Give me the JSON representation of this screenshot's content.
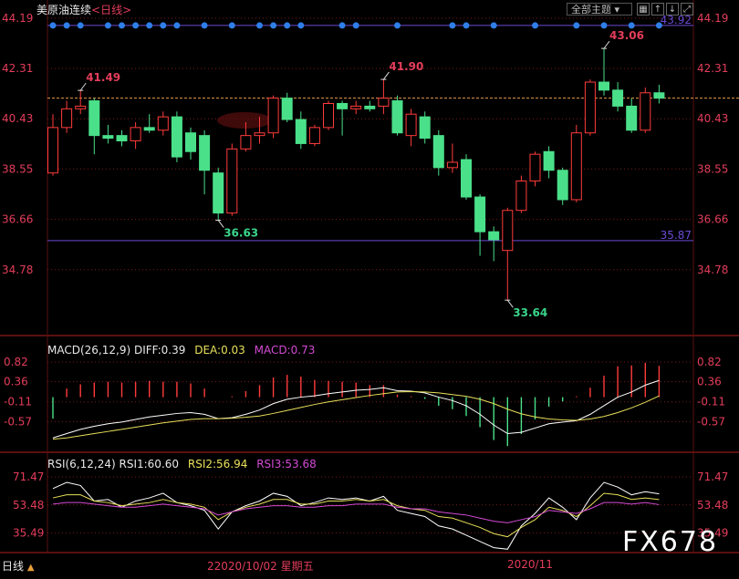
{
  "header": {
    "title": "美原油连续",
    "period": "<日线>",
    "theme_button": "全部主题",
    "tool_icons": [
      "grid-icon",
      "arrow-up-icon",
      "arrow-down-icon",
      "expand-icon"
    ]
  },
  "chart_data": [
    {
      "type": "candlestick",
      "name": "price",
      "ylim": [
        33.1,
        44.19
      ],
      "y_ticks": [
        "44.19",
        "42.31",
        "40.43",
        "38.55",
        "36.66",
        "34.78"
      ],
      "candles": [
        {
          "o": 38.4,
          "h": 40.6,
          "l": 38.3,
          "c": 40.1
        },
        {
          "o": 40.1,
          "h": 41.1,
          "l": 39.9,
          "c": 40.8
        },
        {
          "o": 40.8,
          "h": 41.49,
          "l": 40.6,
          "c": 40.9
        },
        {
          "o": 41.1,
          "h": 41.2,
          "l": 39.1,
          "c": 39.8
        },
        {
          "o": 39.8,
          "h": 40.2,
          "l": 39.5,
          "c": 39.7
        },
        {
          "o": 39.8,
          "h": 40.0,
          "l": 39.4,
          "c": 39.6
        },
        {
          "o": 39.6,
          "h": 40.3,
          "l": 39.3,
          "c": 40.1
        },
        {
          "o": 40.1,
          "h": 40.6,
          "l": 39.9,
          "c": 40.0
        },
        {
          "o": 40.0,
          "h": 40.7,
          "l": 39.8,
          "c": 40.5
        },
        {
          "o": 40.5,
          "h": 40.7,
          "l": 38.8,
          "c": 39.0
        },
        {
          "o": 39.9,
          "h": 40.1,
          "l": 38.9,
          "c": 39.2
        },
        {
          "o": 39.8,
          "h": 40.0,
          "l": 37.6,
          "c": 38.5
        },
        {
          "o": 38.4,
          "h": 38.6,
          "l": 36.63,
          "c": 36.9
        },
        {
          "o": 36.9,
          "h": 39.5,
          "l": 36.8,
          "c": 39.3
        },
        {
          "o": 39.3,
          "h": 40.3,
          "l": 39.2,
          "c": 39.8
        },
        {
          "o": 39.8,
          "h": 40.5,
          "l": 39.5,
          "c": 39.9
        },
        {
          "o": 39.9,
          "h": 41.3,
          "l": 39.7,
          "c": 41.2
        },
        {
          "o": 41.2,
          "h": 41.4,
          "l": 40.3,
          "c": 40.4
        },
        {
          "o": 40.4,
          "h": 40.7,
          "l": 39.3,
          "c": 39.5
        },
        {
          "o": 39.5,
          "h": 40.2,
          "l": 39.4,
          "c": 40.1
        },
        {
          "o": 40.1,
          "h": 41.1,
          "l": 40.0,
          "c": 41.0
        },
        {
          "o": 41.0,
          "h": 41.1,
          "l": 39.8,
          "c": 40.8
        },
        {
          "o": 40.8,
          "h": 41.1,
          "l": 40.6,
          "c": 40.9
        },
        {
          "o": 40.9,
          "h": 41.1,
          "l": 40.7,
          "c": 40.8
        },
        {
          "o": 40.9,
          "h": 41.9,
          "l": 40.6,
          "c": 41.2
        },
        {
          "o": 41.1,
          "h": 41.3,
          "l": 39.8,
          "c": 39.9
        },
        {
          "o": 39.8,
          "h": 40.8,
          "l": 39.4,
          "c": 40.6
        },
        {
          "o": 40.5,
          "h": 40.7,
          "l": 39.5,
          "c": 39.7
        },
        {
          "o": 39.8,
          "h": 40.0,
          "l": 38.3,
          "c": 38.6
        },
        {
          "o": 38.6,
          "h": 39.5,
          "l": 38.4,
          "c": 38.8
        },
        {
          "o": 38.9,
          "h": 39.1,
          "l": 37.4,
          "c": 37.5
        },
        {
          "o": 37.5,
          "h": 37.6,
          "l": 35.3,
          "c": 36.2
        },
        {
          "o": 36.2,
          "h": 36.4,
          "l": 35.1,
          "c": 35.9
        },
        {
          "o": 35.5,
          "h": 37.1,
          "l": 33.64,
          "c": 37.0
        },
        {
          "o": 37.0,
          "h": 38.3,
          "l": 36.9,
          "c": 38.1
        },
        {
          "o": 38.1,
          "h": 39.2,
          "l": 37.9,
          "c": 39.1
        },
        {
          "o": 39.2,
          "h": 39.4,
          "l": 38.2,
          "c": 38.5
        },
        {
          "o": 38.5,
          "h": 38.6,
          "l": 37.2,
          "c": 37.4
        },
        {
          "o": 37.4,
          "h": 40.2,
          "l": 37.3,
          "c": 39.9
        },
        {
          "o": 39.9,
          "h": 41.9,
          "l": 39.8,
          "c": 41.8
        },
        {
          "o": 41.8,
          "h": 43.06,
          "l": 41.3,
          "c": 41.5
        },
        {
          "o": 41.5,
          "h": 41.8,
          "l": 40.7,
          "c": 40.9
        },
        {
          "o": 40.9,
          "h": 41.2,
          "l": 39.9,
          "c": 40.0
        },
        {
          "o": 40.0,
          "h": 41.6,
          "l": 39.9,
          "c": 41.4
        },
        {
          "o": 41.4,
          "h": 41.7,
          "l": 41.0,
          "c": 41.2
        }
      ],
      "level_lines": [
        {
          "value": 43.92,
          "label": "43.92",
          "color": "#6a4ad4"
        },
        {
          "value": 35.87,
          "label": "35.87",
          "color": "#6a4ad4"
        },
        {
          "value": 41.2,
          "label": "",
          "color": "#e89a4a",
          "dashed": true
        }
      ],
      "annotations": [
        {
          "index": 2,
          "value": 41.49,
          "label": "41.49",
          "position": "above",
          "color": "#e33d5a"
        },
        {
          "index": 12,
          "value": 36.63,
          "label": "36.63",
          "position": "below",
          "color": "#3ad48a"
        },
        {
          "index": 24,
          "value": 41.9,
          "label": "41.90",
          "position": "above",
          "color": "#e33d5a"
        },
        {
          "index": 33,
          "value": 33.64,
          "label": "33.64",
          "position": "below",
          "color": "#3ad48a"
        },
        {
          "index": 40,
          "value": 43.06,
          "label": "43.06",
          "position": "above",
          "color": "#e33d5a"
        }
      ],
      "dot_rows": [
        0,
        1,
        2,
        4,
        5,
        6,
        7,
        8,
        9,
        11,
        13,
        15,
        16,
        17,
        18,
        21,
        22,
        25,
        29,
        30,
        32,
        35,
        38,
        40,
        42,
        44
      ]
    },
    {
      "type": "line",
      "name": "macd",
      "title": "MACD(26,12,9)",
      "ylim": [
        -1.2,
        0.82
      ],
      "y_ticks": [
        "0.82",
        "0.36",
        "-0.11",
        "-0.57"
      ],
      "series": [
        {
          "name": "DIFF",
          "value_text": "DIFF:0.39",
          "color": "#ffffff",
          "values": [
            -0.95,
            -0.85,
            -0.75,
            -0.68,
            -0.62,
            -0.58,
            -0.52,
            -0.46,
            -0.42,
            -0.38,
            -0.36,
            -0.4,
            -0.5,
            -0.48,
            -0.4,
            -0.3,
            -0.15,
            -0.05,
            0.0,
            0.03,
            0.08,
            0.12,
            0.16,
            0.18,
            0.22,
            0.15,
            0.14,
            0.1,
            0.0,
            -0.08,
            -0.2,
            -0.4,
            -0.65,
            -0.85,
            -0.82,
            -0.72,
            -0.62,
            -0.58,
            -0.55,
            -0.4,
            -0.2,
            0.0,
            0.12,
            0.28,
            0.39
          ]
        },
        {
          "name": "DEA",
          "value_text": "DEA:0.03",
          "color": "#e8e05a",
          "values": [
            -0.98,
            -0.95,
            -0.9,
            -0.85,
            -0.8,
            -0.75,
            -0.7,
            -0.65,
            -0.6,
            -0.56,
            -0.52,
            -0.5,
            -0.5,
            -0.49,
            -0.47,
            -0.44,
            -0.38,
            -0.31,
            -0.24,
            -0.17,
            -0.11,
            -0.06,
            -0.01,
            0.04,
            0.08,
            0.12,
            0.13,
            0.12,
            0.1,
            0.06,
            0.02,
            -0.05,
            -0.15,
            -0.28,
            -0.39,
            -0.46,
            -0.51,
            -0.53,
            -0.54,
            -0.51,
            -0.45,
            -0.36,
            -0.25,
            -0.12,
            0.03
          ]
        },
        {
          "name": "MACD",
          "value_text": "MACD:0.73",
          "color": "#d44ad4"
        }
      ],
      "histogram": [
        -0.5,
        0.2,
        0.3,
        0.34,
        0.36,
        0.34,
        0.36,
        0.38,
        0.36,
        0.36,
        0.32,
        0.2,
        0.0,
        0.02,
        0.14,
        0.28,
        0.46,
        0.52,
        0.48,
        0.4,
        0.38,
        0.36,
        0.34,
        0.28,
        0.28,
        0.06,
        0.02,
        -0.04,
        -0.2,
        -0.28,
        -0.44,
        -0.7,
        -1.0,
        -1.14,
        -0.86,
        -0.52,
        -0.22,
        -0.1,
        0.02,
        0.22,
        0.5,
        0.72,
        0.74,
        0.8,
        0.73
      ]
    },
    {
      "type": "line",
      "name": "rsi",
      "title": "RSI(6,12,24)",
      "ylim": [
        24,
        78
      ],
      "y_ticks": [
        "71.47",
        "53.48",
        "35.49"
      ],
      "series": [
        {
          "name": "RSI1",
          "value_text": "RSI1:60.60",
          "color": "#ffffff",
          "values": [
            64,
            68,
            66,
            56,
            57,
            52,
            56,
            58,
            61,
            55,
            53,
            50,
            38,
            49,
            53,
            56,
            61,
            59,
            53,
            55,
            58,
            57,
            58,
            56,
            59,
            50,
            48,
            46,
            40,
            38,
            34,
            30,
            26,
            25,
            40,
            48,
            58,
            52,
            44,
            58,
            68,
            65,
            60,
            62,
            60.6
          ]
        },
        {
          "name": "RSI2",
          "value_text": "RSI2:56.94",
          "color": "#e8e05a",
          "values": [
            58,
            60,
            60,
            56,
            55,
            53,
            54,
            55,
            57,
            55,
            54,
            52,
            44,
            49,
            52,
            54,
            57,
            57,
            54,
            54,
            56,
            56,
            57,
            56,
            57,
            53,
            51,
            50,
            46,
            45,
            42,
            39,
            35,
            33,
            39,
            44,
            52,
            50,
            46,
            53,
            61,
            60,
            57,
            58,
            56.94
          ]
        },
        {
          "name": "RSI3",
          "value_text": "RSI3:53.68",
          "color": "#d44ad4",
          "values": [
            54,
            55,
            55,
            54,
            53,
            52,
            52,
            53,
            54,
            53,
            52,
            51,
            47,
            49,
            51,
            52,
            53,
            53,
            52,
            52,
            53,
            53,
            54,
            54,
            54,
            52,
            51,
            51,
            49,
            48,
            47,
            45,
            43,
            42,
            44,
            46,
            50,
            49,
            48,
            51,
            55,
            55,
            54,
            55,
            53.68
          ]
        }
      ]
    }
  ],
  "bottom": {
    "tab": "日线",
    "tab_arrow": "▲",
    "cursor_date_prefix": "2",
    "cursor_date": "2020/10/02 星期五",
    "month_label": "2020/11"
  },
  "watermark": "FX678",
  "colors": {
    "up": "#ff3b3b",
    "down": "#4ae08a",
    "grid_red": "#7a1a1a",
    "axis_label": "#e33d5a",
    "dot": "#2f7fe8"
  }
}
